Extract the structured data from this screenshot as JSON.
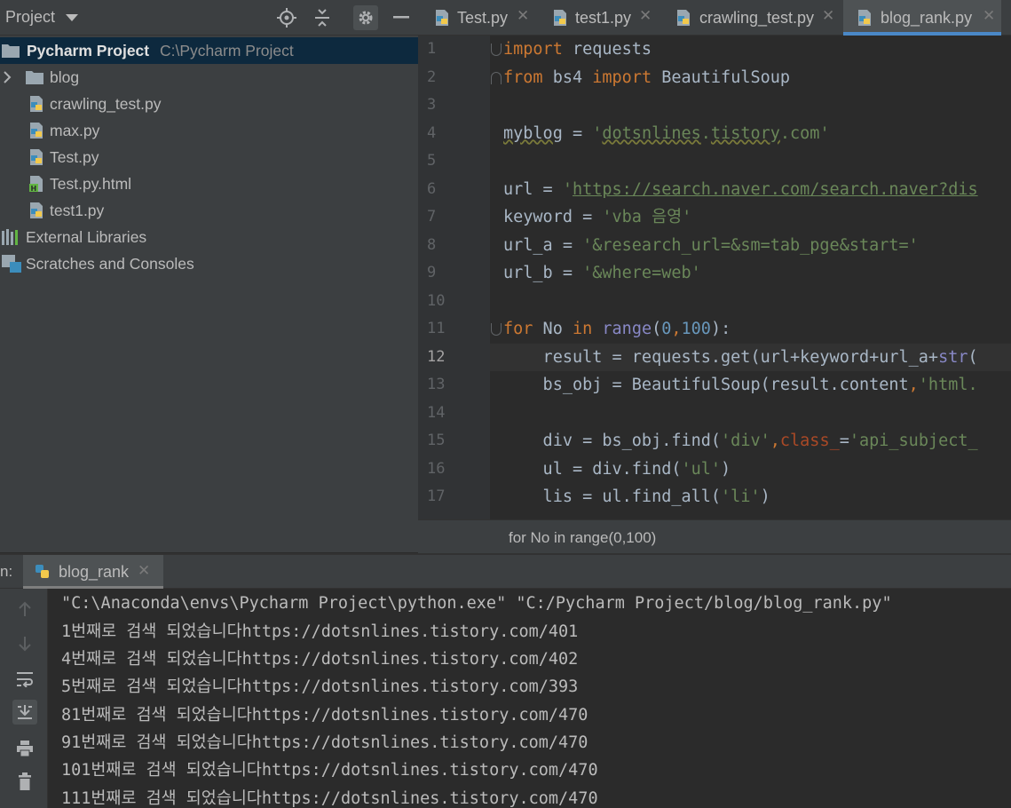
{
  "project": {
    "title": "Project",
    "root_name": "Pycharm Project",
    "root_path": "C:\\Pycharm Project",
    "items": [
      {
        "label": "blog",
        "icon": "folder-icon"
      },
      {
        "label": "crawling_test.py",
        "icon": "python-file-icon"
      },
      {
        "label": "max.py",
        "icon": "python-file-icon"
      },
      {
        "label": "Test.py",
        "icon": "python-file-icon"
      },
      {
        "label": "Test.py.html",
        "icon": "html-file-icon"
      },
      {
        "label": "test1.py",
        "icon": "python-file-icon"
      },
      {
        "label": "External Libraries",
        "icon": "libraries-icon"
      },
      {
        "label": "Scratches and Consoles",
        "icon": "scratches-icon"
      }
    ]
  },
  "tabs": [
    {
      "label": "Test.py"
    },
    {
      "label": "test1.py"
    },
    {
      "label": "crawling_test.py"
    },
    {
      "label": "blog_rank.py",
      "active": true
    }
  ],
  "editor": {
    "line_numbers": [
      "1",
      "2",
      "3",
      "4",
      "5",
      "6",
      "7",
      "8",
      "9",
      "10",
      "11",
      "12",
      "13",
      "14",
      "15",
      "16",
      "17"
    ],
    "current_line": "12"
  },
  "breadcrumb": "for No in range(0,100)",
  "run": {
    "label": "n:",
    "tab_label": "blog_rank",
    "output": [
      "\"C:\\Anaconda\\envs\\Pycharm Project\\python.exe\" \"C:/Pycharm Project/blog/blog_rank.py\"",
      "1번째로 검색 되었습니다https://dotsnlines.tistory.com/401",
      "4번째로 검색 되었습니다https://dotsnlines.tistory.com/402",
      "5번째로 검색 되었습니다https://dotsnlines.tistory.com/393",
      "81번째로 검색 되었습니다https://dotsnlines.tistory.com/470",
      "91번째로 검색 되었습니다https://dotsnlines.tistory.com/470",
      "101번째로 검색 되었습니다https://dotsnlines.tistory.com/470",
      "111번째로 검색 되었습니다https://dotsnlines.tistory.com/470"
    ]
  },
  "colors": {
    "accent": "#4a88c7",
    "keyword": "#cc7832",
    "string": "#6a8759",
    "number": "#6897bb",
    "selection": "#0d293e"
  }
}
